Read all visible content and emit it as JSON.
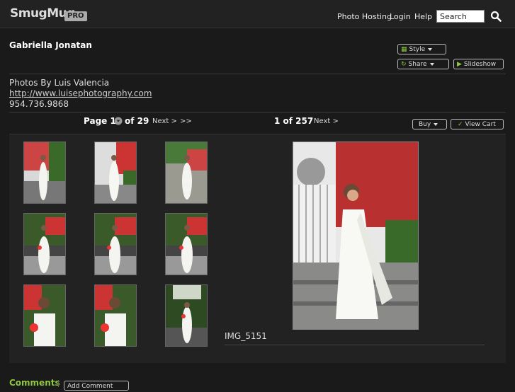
{
  "header": {
    "logo": "SmugMug",
    "badge": "PRO",
    "nav": [
      "Photo Hosting",
      "Login",
      "Help"
    ],
    "search_value": "Search",
    "search_icon": "search-icon"
  },
  "gallery_owner": "Gabriella Jonatan",
  "buttons": {
    "style": "Style",
    "share": "Share",
    "slideshow": "Slideshow",
    "buy": "Buy",
    "view_cart": "View Cart"
  },
  "info": {
    "photographer": "Photos By Luis Valencia",
    "website": "http://www.luisephotography.com",
    "phone": "954.736.9868"
  },
  "pager": {
    "page_label": "Page 1",
    "of_pages": "of 29",
    "next": "Next >",
    "last": ">>",
    "position": "1 of 257",
    "next_photo": "Next >"
  },
  "photo_caption": "IMG_5151",
  "comments": {
    "title": "Comments",
    "add": "Add Comment"
  },
  "colors": {
    "accent": "#8ec63f",
    "background": "#1a1a1a"
  }
}
